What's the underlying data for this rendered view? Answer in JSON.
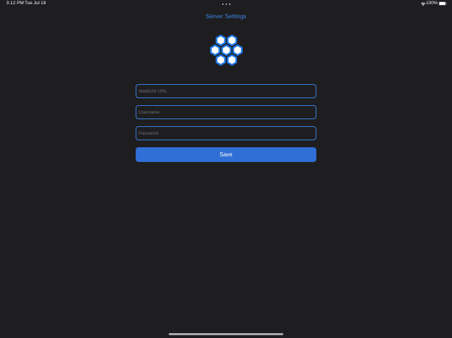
{
  "status_bar": {
    "time": "3:12 PM",
    "date": "Tue Jul 18",
    "battery": "100%",
    "icons": [
      "wifi-icon",
      "battery-icon",
      "multitasking-dots-icon"
    ]
  },
  "header": {
    "title": "Server Settings"
  },
  "logo": {
    "icon": "hexagon-cluster-icon",
    "color": "#1f78e6"
  },
  "form": {
    "url_placeholder": "WebDAV URL",
    "url_value": "",
    "username_placeholder": "Username",
    "username_value": "",
    "password_placeholder": "Password",
    "password_value": "",
    "save_label": "Save"
  },
  "colors": {
    "background": "#1e1e20",
    "accent": "#3d86e8",
    "button": "#2f6fd6"
  }
}
